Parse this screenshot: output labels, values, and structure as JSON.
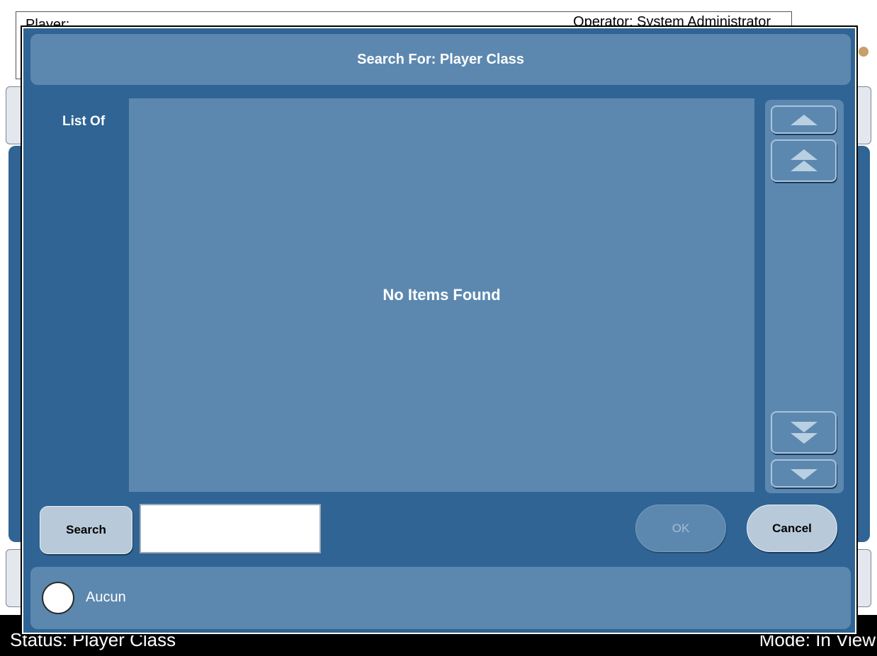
{
  "background": {
    "player_label": "Player:",
    "operator_label": "Operator: System Administrator",
    "status_text": "Status: Player Class",
    "mode_text": "Mode: In View"
  },
  "dialog": {
    "title": "Search For: Player Class",
    "list_label": "List Of",
    "empty_message": "No Items Found",
    "search_button": "Search",
    "search_value": "",
    "ok_button": "OK",
    "cancel_button": "Cancel",
    "radio_option": "Aucun"
  },
  "icons": {
    "scroll_up": "triangle-up-icon",
    "page_up": "double-triangle-up-icon",
    "page_down": "double-triangle-down-icon",
    "scroll_down": "triangle-down-icon"
  },
  "colors": {
    "dialog_bg": "#2f6494",
    "panel_bg": "#5c88b0",
    "button_bg": "#b8cad9",
    "status_bar": "#000000"
  }
}
